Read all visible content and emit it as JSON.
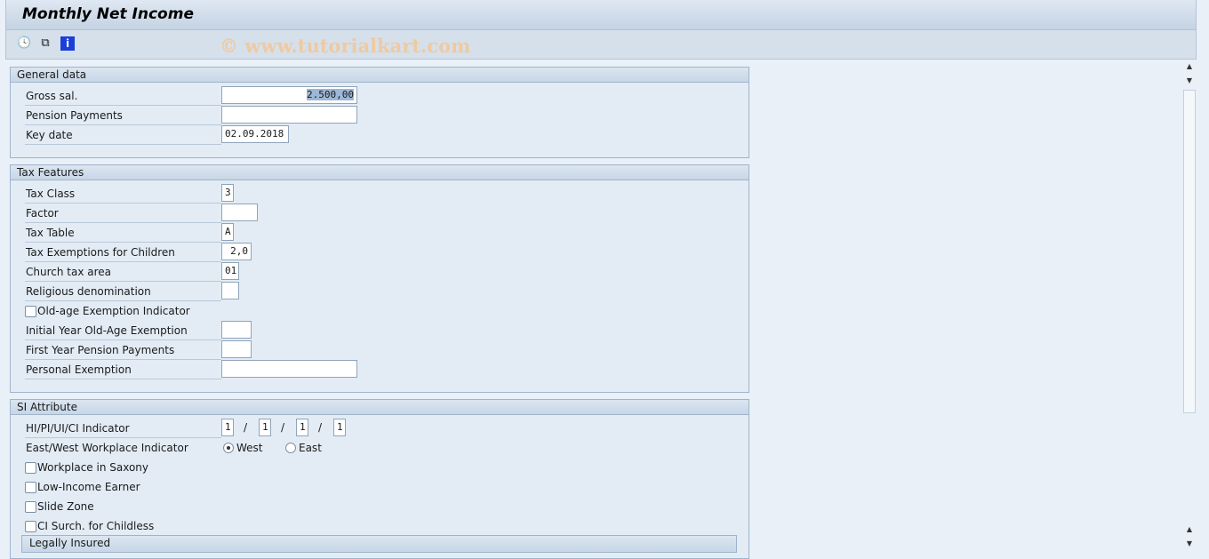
{
  "title": "Monthly Net Income",
  "watermark": "© www.tutorialkart.com",
  "toolbar": {
    "icons": [
      "execute-clock-icon",
      "copy-icon",
      "info-icon"
    ]
  },
  "general": {
    "header": "General data",
    "gross_label": "Gross sal.",
    "gross_value": "2.500,00",
    "pension_label": "Pension Payments",
    "pension_value": "",
    "keydate_label": "Key date",
    "keydate_value": "02.09.2018"
  },
  "tax": {
    "header": "Tax Features",
    "tax_class_label": "Tax Class",
    "tax_class": "3",
    "factor_label": "Factor",
    "factor": "",
    "tax_table_label": "Tax Table",
    "tax_table": "A",
    "children_label": "Tax Exemptions for Children",
    "children": "2,0",
    "church_label": "Church tax area",
    "church": "01",
    "religion_label": "Religious denomination",
    "religion": "",
    "oldage_label": "Old-age Exemption Indicator",
    "oldage_checked": false,
    "initial_label": "Initial Year Old-Age Exemption",
    "initial": "",
    "firstyear_label": "First Year Pension Payments",
    "firstyear": "",
    "personal_label": "Personal Exemption",
    "personal": ""
  },
  "si": {
    "header": "SI Attribute",
    "ind_label": "HI/PI/UI/CI Indicator",
    "ind": [
      "1",
      "1",
      "1",
      "1"
    ],
    "sep": "/",
    "eastwest_label": "East/West Workplace Indicator",
    "west": "West",
    "east": "East",
    "selected": "West",
    "saxony": "Workplace in Saxony",
    "lowincome": "Low-Income Earner",
    "slide": "Slide Zone",
    "childless": "CI Surch. for Childless",
    "legally": "Legally Insured"
  }
}
